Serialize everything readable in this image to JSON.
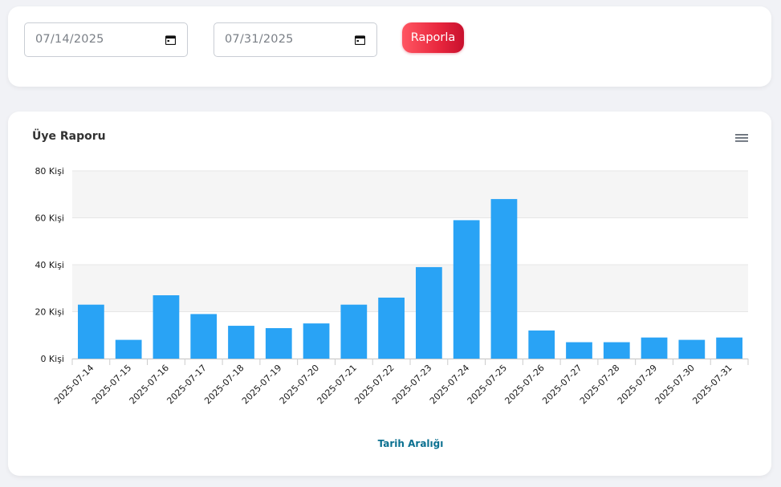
{
  "filter": {
    "start_date": "07/14/2025",
    "end_date": "07/31/2025",
    "report_button_label": "Raporla",
    "calendar_icon": "calendar-icon"
  },
  "chart": {
    "title": "Üye Raporu",
    "menu_icon": "hamburger-menu-icon"
  },
  "colors": {
    "bar": "#29a3f5",
    "button_gradient_start": "#ff5662",
    "button_gradient_end": "#c8102e",
    "axis_title": "#0a7090"
  },
  "chart_data": {
    "type": "bar",
    "title": "Üye Raporu",
    "xlabel": "Tarih Aralığı",
    "ylabel": "",
    "y_tick_suffix": " Kişi",
    "ylim": [
      0,
      80
    ],
    "y_ticks": [
      0,
      20,
      40,
      60,
      80
    ],
    "grid": "alternating horizontal bands",
    "categories": [
      "2025-07-14",
      "2025-07-15",
      "2025-07-16",
      "2025-07-17",
      "2025-07-18",
      "2025-07-19",
      "2025-07-20",
      "2025-07-21",
      "2025-07-22",
      "2025-07-23",
      "2025-07-24",
      "2025-07-25",
      "2025-07-26",
      "2025-07-27",
      "2025-07-28",
      "2025-07-29",
      "2025-07-30",
      "2025-07-31"
    ],
    "values": [
      23,
      8,
      27,
      19,
      14,
      13,
      15,
      23,
      26,
      39,
      59,
      68,
      12,
      7,
      7,
      9,
      8,
      9
    ]
  }
}
